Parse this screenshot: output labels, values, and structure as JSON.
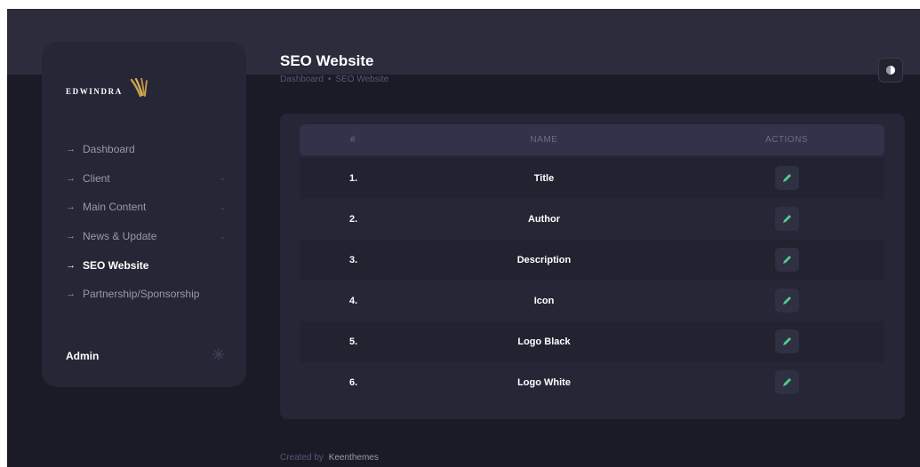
{
  "app": {
    "logo_text": "EDWINDRA"
  },
  "sidebar": {
    "items": [
      {
        "label": "Dashboard",
        "arrow": "→",
        "chevron": ""
      },
      {
        "label": "Client",
        "arrow": "→",
        "chevron": "⌄"
      },
      {
        "label": "Main Content",
        "arrow": "→",
        "chevron": "⌄"
      },
      {
        "label": "News & Update",
        "arrow": "→",
        "chevron": "⌄"
      },
      {
        "label": "SEO Website",
        "arrow": "→",
        "chevron": "",
        "active": true
      },
      {
        "label": "Partnership/Sponsorship",
        "arrow": "→",
        "chevron": ""
      }
    ],
    "user_label": "Admin"
  },
  "header": {
    "title": "SEO Website",
    "breadcrumb": [
      "Dashboard",
      "SEO Website"
    ],
    "breadcrumb_sep": "•"
  },
  "table": {
    "headers": [
      "#",
      "NAME",
      "ACTIONS"
    ],
    "rows": [
      {
        "num": "1.",
        "name": "Title"
      },
      {
        "num": "2.",
        "name": "Author"
      },
      {
        "num": "3.",
        "name": "Description"
      },
      {
        "num": "4.",
        "name": "Icon"
      },
      {
        "num": "5.",
        "name": "Logo Black"
      },
      {
        "num": "6.",
        "name": "Logo White"
      }
    ]
  },
  "footer": {
    "prefix": "Created by",
    "link": "Keenthemes"
  },
  "colors": {
    "background": "#1b1b28",
    "panel": "#262636",
    "accent_edit": "#50cd89",
    "logo_gold": "#c9a14a"
  },
  "icons": {
    "nav_arrow": "arrow-right-icon",
    "edit": "pencil-icon",
    "theme": "moon-icon",
    "settings": "gear-icon"
  }
}
